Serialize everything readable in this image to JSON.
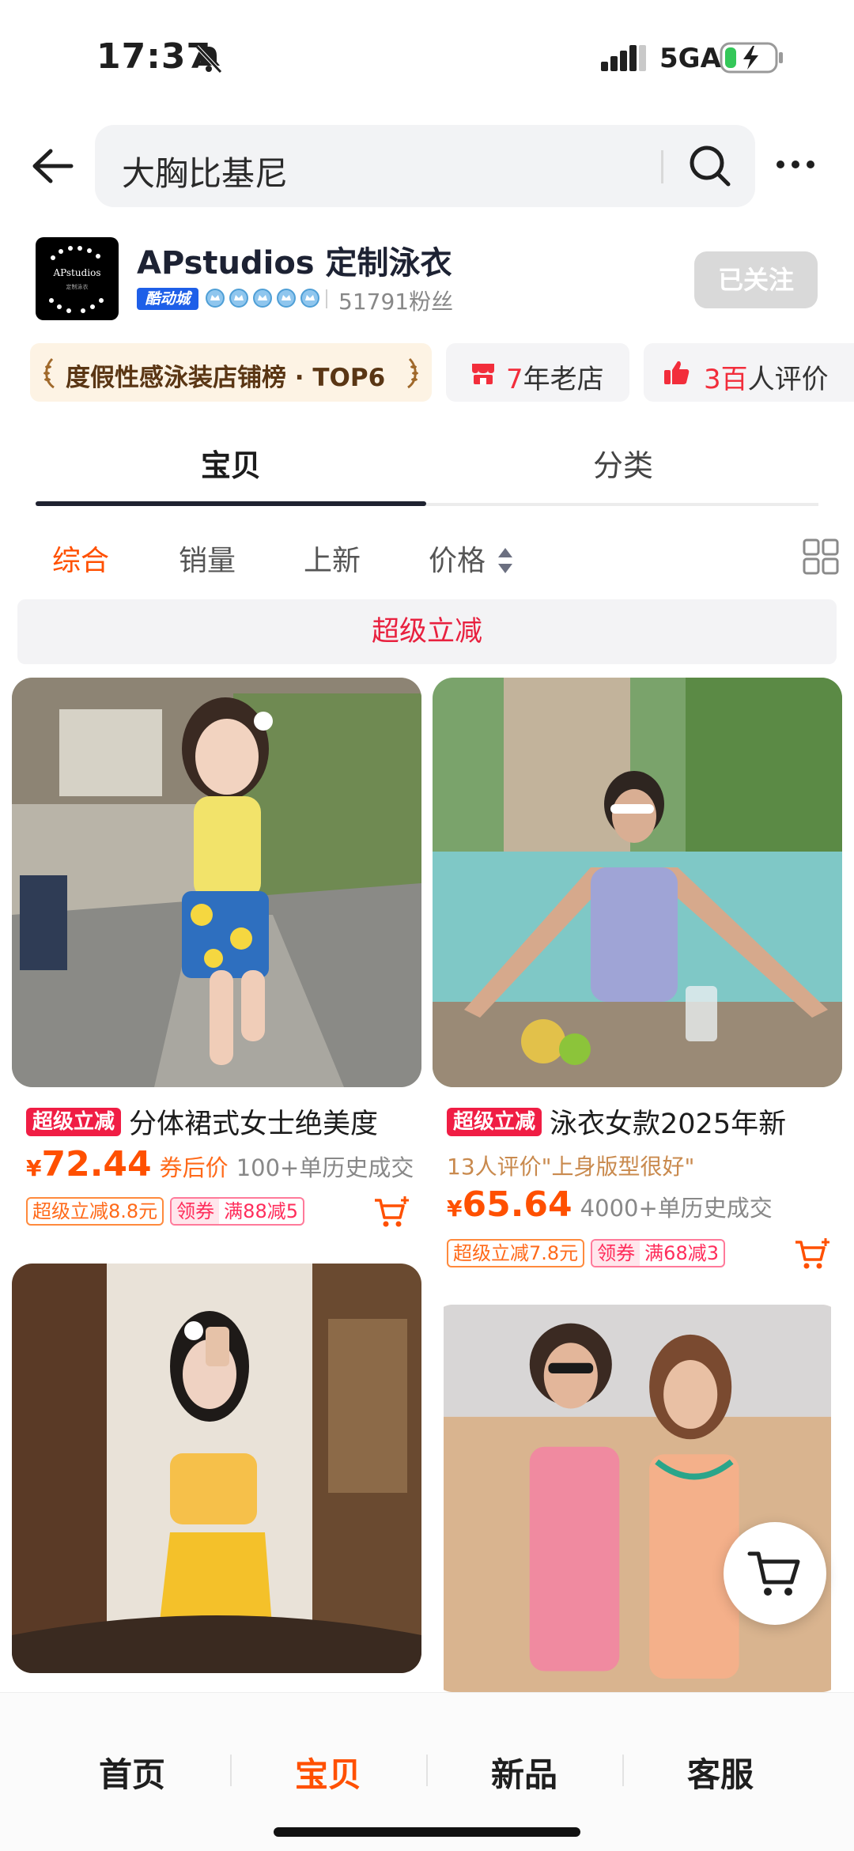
{
  "status_bar": {
    "time": "17:37",
    "network": "5GA",
    "battery_state": "charging"
  },
  "search": {
    "query": "大胸比基尼"
  },
  "store": {
    "logo_text": "APstudios",
    "logo_subtext": "定制泳衣",
    "name": "APstudios 定制泳衣",
    "badge": "酷动城",
    "crown_count": 5,
    "fans": "51791粉丝",
    "follow_label": "已关注"
  },
  "tags": {
    "rank": "度假性感泳装店铺榜 · TOP6",
    "age_number": "7",
    "age_suffix": "年老店",
    "reviews_number": "3百",
    "reviews_suffix": "人评价"
  },
  "main_tabs": [
    "宝贝",
    "分类"
  ],
  "sort": {
    "items": [
      "综合",
      "销量",
      "上新",
      "价格"
    ]
  },
  "promo_banner": "超级立减",
  "products": [
    {
      "badge": "超级立减",
      "title": "分体裙式女士绝美度",
      "price": "72.44",
      "price_note": "券后价",
      "sold": "100+单历史成交",
      "coupon_promo": "超级立减8.8元",
      "coupon_label": "领券",
      "coupon_value": "满88减5"
    },
    {
      "badge": "超级立减",
      "title": "泳衣女款2025年新",
      "review": "13人评价\"上身版型很好\"",
      "price": "65.64",
      "sold": "4000+单历史成交",
      "coupon_promo": "超级立减7.8元",
      "coupon_label": "领券",
      "coupon_value": "满68减3"
    }
  ],
  "currency_symbol": "¥",
  "bottom_nav": [
    "首页",
    "宝贝",
    "新品",
    "客服"
  ],
  "colors": {
    "accent": "#ff5000",
    "promo_red": "#f01d44",
    "tab_indicator": "#1f2230"
  }
}
